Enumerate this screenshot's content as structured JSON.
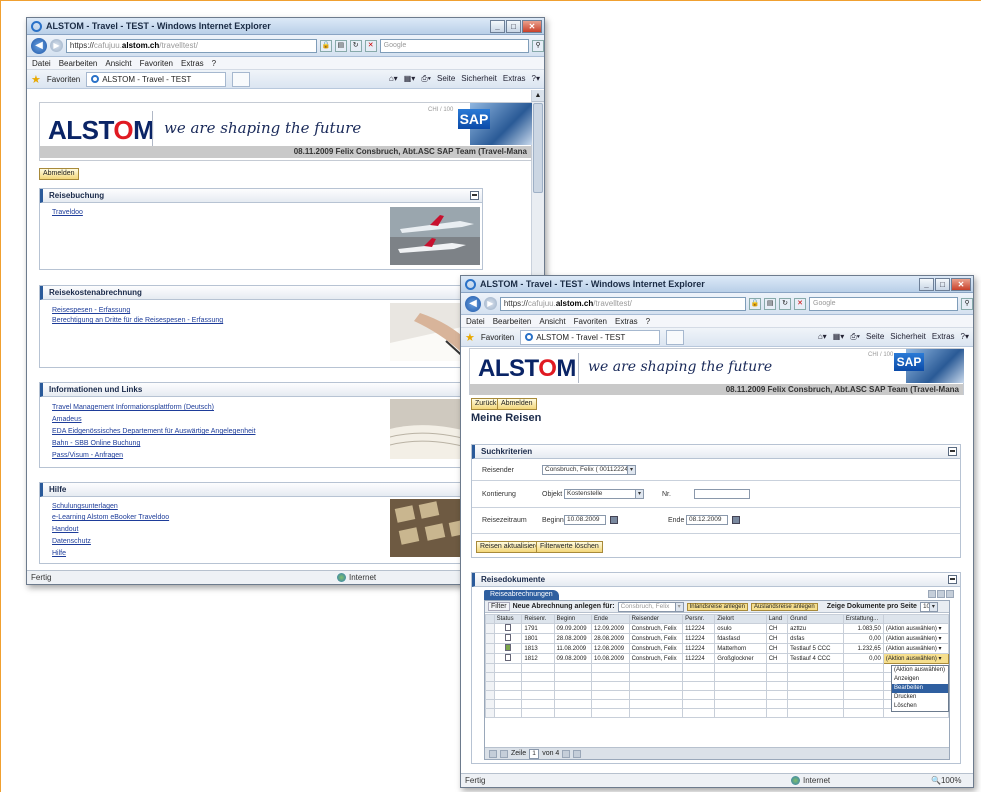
{
  "win1": {
    "title": "ALSTOM - Travel - TEST - Windows Internet Explorer",
    "url_prefix": "https://",
    "url_grey1": "cafujuu.",
    "url_domain": "alstom.ch",
    "url_grey2": "/travelltest/",
    "search_placeholder": "Google",
    "menu": [
      "Datei",
      "Bearbeiten",
      "Ansicht",
      "Favoriten",
      "Extras",
      "?"
    ],
    "favorites": "Favoriten",
    "tab_title": "ALSTOM - Travel - TEST",
    "tools": [
      "Seite",
      "Sicherheit",
      "Extras"
    ],
    "slogan": "we are shaping the future",
    "chi": "CHI / 100",
    "user_line": "08.11.2009   Felix Consbruch, Abt.ASC SAP Team (Travel-Mana",
    "logout": "Abmelden",
    "sections": [
      {
        "title": "Reisebuchung",
        "links": [
          "Traveldoo"
        ]
      },
      {
        "title": "Reisekostenabrechnung",
        "links": [
          "Reisespesen - Erfassung",
          "Berechtigung an Dritte für die Reisespesen - Erfassung"
        ]
      },
      {
        "title": "Informationen und Links",
        "links": [
          "Travel Management Informationsplattform (Deutsch)",
          "Amadeus",
          "EDA Eidgenössisches Departement für Auswärtige Angelegenheit",
          "Bahn - SBB Online Buchung",
          "Pass/Visum - Anfragen"
        ]
      },
      {
        "title": "Hilfe",
        "links": [
          "Schulungsunterlagen",
          "e-Learning Alstom eBooker Traveldoo",
          "Handout",
          "Datenschutz",
          "Hilfe"
        ]
      }
    ],
    "status": "Fertig",
    "zone": "Internet"
  },
  "win2": {
    "title": "ALSTOM - Travel - TEST - Windows Internet Explorer",
    "url_prefix": "https://",
    "url_grey1": "cafujuu.",
    "url_domain": "alstom.ch",
    "url_grey2": "/travelltest/",
    "search_placeholder": "Google",
    "menu": [
      "Datei",
      "Bearbeiten",
      "Ansicht",
      "Favoriten",
      "Extras",
      "?"
    ],
    "favorites": "Favoriten",
    "tab_title": "ALSTOM - Travel - TEST",
    "tools": [
      "Seite",
      "Sicherheit",
      "Extras"
    ],
    "slogan": "we are shaping the future",
    "chi": "CHI / 100",
    "user_line": "08.11.2009   Felix Consbruch, Abt.ASC SAP Team (Travel-Mana",
    "back": "Zurück",
    "logout": "Abmelden",
    "page_title": "Meine Reisen",
    "criteria_title": "Suchkriterien",
    "traveler_label": "Reisender",
    "traveler_value": "Consbruch, Felix ( 00112224 )",
    "account_label": "Kontierung",
    "object_label": "Objekt",
    "object_value": "Kostenstelle",
    "nr_label": "Nr.",
    "period_label": "Reisezeitraum",
    "begin_label": "Beginn",
    "begin_value": "10.08.2009",
    "end_label": "Ende",
    "end_value": "08.12.2009",
    "refresh_btn": "Reisen aktualisieren",
    "clear_btn": "Filterwerte löschen",
    "docs_title": "Reisedokumente",
    "tab_label": "Reiseabrechnungen",
    "filter": "Filter",
    "new_label": "Neue Abrechnung anlegen für:",
    "new_value": "Consbruch, Felix",
    "domestic_btn": "Inlandsreise anlegen",
    "foreign_btn": "Auslandsreise anlegen",
    "per_page_label": "Zeige Dokumente pro Seite",
    "per_page_value": "10",
    "columns": [
      "Status",
      "Reisenr.",
      "Beginn",
      "Ende",
      "Reisender",
      "Persnr.",
      "Zielort",
      "Land",
      "Grund",
      "Erstattung..."
    ],
    "rows": [
      {
        "nr": "1791",
        "begin": "09.09.2009",
        "end": "12.09.2009",
        "traveler": "Consbruch, Felix",
        "pnr": "112224",
        "dest": "osulo",
        "land": "CH",
        "reason": "azttzu",
        "amount": "1.083,50",
        "action": "(Aktion auswählen)",
        "checked": false
      },
      {
        "nr": "1801",
        "begin": "28.08.2009",
        "end": "28.08.2009",
        "traveler": "Consbruch, Felix",
        "pnr": "112224",
        "dest": "fdasfasd",
        "land": "CH",
        "reason": "dsfas",
        "amount": "0,00",
        "action": "(Aktion auswählen)",
        "checked": false
      },
      {
        "nr": "1813",
        "begin": "11.08.2009",
        "end": "12.08.2009",
        "traveler": "Consbruch, Felix",
        "pnr": "112224",
        "dest": "Matterhorn",
        "land": "CH",
        "reason": "Testlauf 5 CCC",
        "amount": "1.232,65",
        "action": "(Aktion auswählen)",
        "checked": true
      },
      {
        "nr": "1812",
        "begin": "09.08.2009",
        "end": "10.08.2009",
        "traveler": "Consbruch, Felix",
        "pnr": "112224",
        "dest": "Großglockner",
        "land": "CH",
        "reason": "Testlauf 4 CCC",
        "amount": "0,00",
        "action": "(Aktion auswählen)",
        "checked": false
      }
    ],
    "action_menu": [
      "(Aktion auswählen)",
      "Anzeigen",
      "Bearbeiten",
      "Drucken",
      "Löschen"
    ],
    "pager_label": "Zeile",
    "pager_value": "1",
    "pager_of": "von 4",
    "status": "Fertig",
    "zone": "Internet",
    "zoom": "100%"
  }
}
